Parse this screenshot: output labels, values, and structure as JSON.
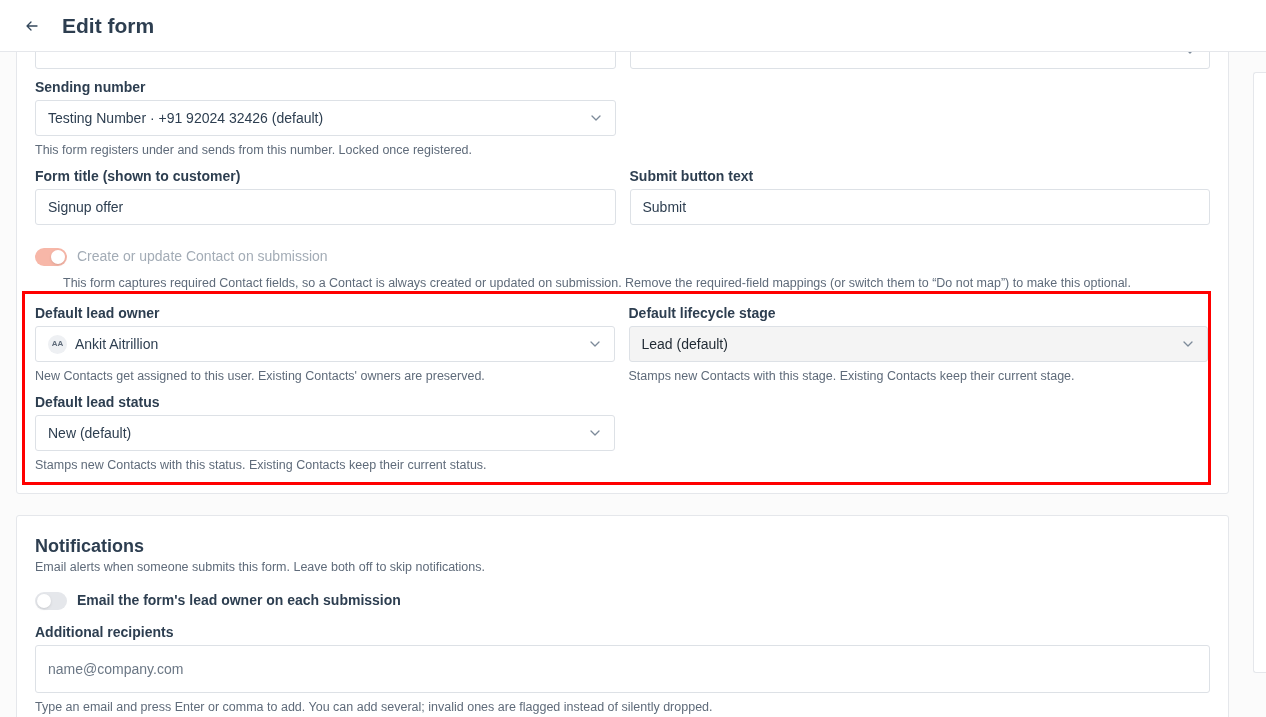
{
  "header": {
    "title": "Edit form"
  },
  "form_rows": [
    [
      {
        "kind": "text"
      },
      {
        "kind": "select"
      }
    ],
    [
      {
        "kind": "select",
        "label": "Sending number",
        "value": "Testing Number · +91 92024 32426 (default)",
        "help": "This form registers under and sends from this number. Locked once registered."
      }
    ],
    [
      {
        "kind": "text",
        "label": "Form title (shown to customer)",
        "value": "Signup offer"
      },
      {
        "kind": "text",
        "label": "Submit button text",
        "value": "Submit"
      }
    ]
  ],
  "contact_toggle": {
    "label": "Create or update Contact on submission",
    "on": true,
    "disabled": true,
    "description": "This form captures required Contact fields, so a Contact is always created or updated on submission. Remove the required-field mappings (or switch them to “Do not map”) to make this optional."
  },
  "default_rows": [
    [
      {
        "kind": "select",
        "label": "Default lead owner",
        "avatar": "AA",
        "value": "Ankit Aitrillion",
        "help": "New Contacts get assigned to this user. Existing Contacts' owners are preserved."
      },
      {
        "kind": "select",
        "label": "Default lifecycle stage",
        "value": "Lead (default)",
        "help": "Stamps new Contacts with this stage. Existing Contacts keep their current stage.",
        "disabled": true
      }
    ],
    [
      {
        "kind": "select",
        "label": "Default lead status",
        "value": "New (default)",
        "help": "Stamps new Contacts with this status. Existing Contacts keep their current status."
      }
    ]
  ],
  "notifications": {
    "title": "Notifications",
    "description": "Email alerts when someone submits this form. Leave both off to skip notifications.",
    "toggle": {
      "label": "Email the form's lead owner on each submission",
      "on": false
    },
    "recipients": {
      "label": "Additional recipients",
      "placeholder": "name@company.com",
      "help": "Type an email and press Enter or comma to add. You can add several; invalid ones are flagged instead of silently dropped."
    }
  }
}
